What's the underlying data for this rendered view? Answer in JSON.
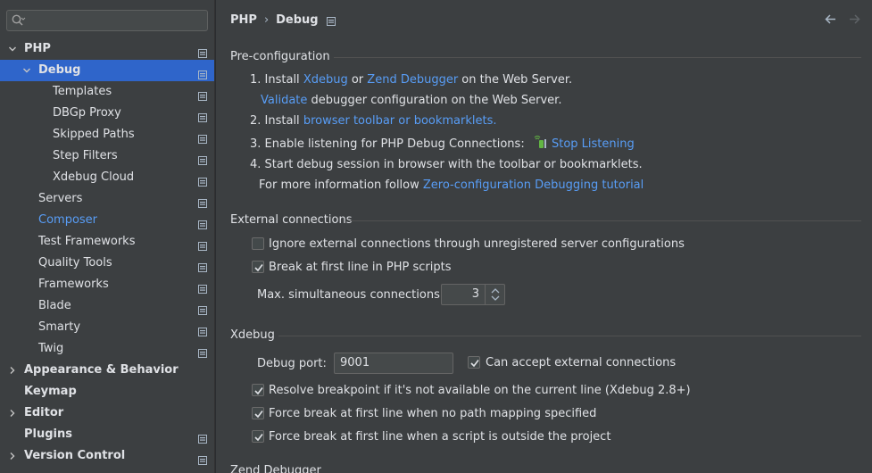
{
  "search": {
    "placeholder": ""
  },
  "sidebar": {
    "items": [
      {
        "label": "PHP",
        "level": 0,
        "bold": true,
        "expanded": true,
        "arrow": "down"
      },
      {
        "label": "Debug",
        "level": 1,
        "bold": true,
        "selected": true,
        "arrow": "down"
      },
      {
        "label": "Templates",
        "level": 2
      },
      {
        "label": "DBGp Proxy",
        "level": 2
      },
      {
        "label": "Skipped Paths",
        "level": 2
      },
      {
        "label": "Step Filters",
        "level": 2
      },
      {
        "label": "Xdebug Cloud",
        "level": 2
      },
      {
        "label": "Servers",
        "level": 1
      },
      {
        "label": "Composer",
        "level": 1,
        "link": true
      },
      {
        "label": "Test Frameworks",
        "level": 1
      },
      {
        "label": "Quality Tools",
        "level": 1
      },
      {
        "label": "Frameworks",
        "level": 1
      },
      {
        "label": "Blade",
        "level": 1
      },
      {
        "label": "Smarty",
        "level": 1
      },
      {
        "label": "Twig",
        "level": 1
      },
      {
        "label": "Appearance & Behavior",
        "level": 0,
        "bold": true,
        "arrow": "right",
        "nogear": true
      },
      {
        "label": "Keymap",
        "level": 0,
        "bold": true,
        "nogear": true
      },
      {
        "label": "Editor",
        "level": 0,
        "bold": true,
        "arrow": "right",
        "nogear": true
      },
      {
        "label": "Plugins",
        "level": 0,
        "bold": true
      },
      {
        "label": "Version Control",
        "level": 0,
        "bold": true,
        "arrow": "right"
      }
    ]
  },
  "breadcrumb": {
    "parent": "PHP",
    "separator": "›",
    "current": "Debug"
  },
  "preconfig": {
    "title": "Pre-configuration",
    "step1_prefix": "1. Install ",
    "step1_link1": "Xdebug",
    "step1_or": " or ",
    "step1_link2": "Zend Debugger",
    "step1_suffix": " on the Web Server.",
    "validate_link": "Validate",
    "validate_suffix": " debugger configuration on the Web Server.",
    "step2_prefix": "2. Install ",
    "step2_link": "browser toolbar or bookmarklets.",
    "step3_text": "3. Enable listening for PHP Debug Connections:",
    "step3_link": "Stop Listening",
    "step4_text": "4. Start debug session in browser with the toolbar or bookmarklets.",
    "more_prefix": "For more information follow ",
    "more_link": "Zero-configuration Debugging tutorial"
  },
  "external": {
    "title": "External connections",
    "ignore_label": "Ignore external connections through unregistered server configurations",
    "ignore_checked": false,
    "break_label": "Break at first line in PHP scripts",
    "break_checked": true,
    "max_label": "Max. simultaneous connections:",
    "max_value": "3"
  },
  "xdebug": {
    "title": "Xdebug",
    "port_label": "Debug port:",
    "port_value": "9001",
    "accept_label": "Can accept external connections",
    "accept_checked": true,
    "resolve_label": "Resolve breakpoint if it's not available on the current line (Xdebug 2.8+)",
    "resolve_checked": true,
    "force_nomap_label": "Force break at first line when no path mapping specified",
    "force_nomap_checked": true,
    "force_outside_label": "Force break at first line when a script is outside the project",
    "force_outside_checked": true
  },
  "zend": {
    "title": "Zend Debugger"
  },
  "colors": {
    "accent": "#2f65ca",
    "link": "#589df6",
    "panel": "#3c3f41"
  }
}
